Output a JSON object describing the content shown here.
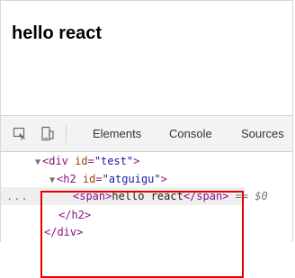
{
  "page": {
    "heading": "hello react"
  },
  "devtools": {
    "tabs": {
      "elements": "Elements",
      "console": "Console",
      "sources": "Sources"
    },
    "icons": {
      "inspect": "inspect-element-icon",
      "device": "device-toolbar-icon"
    },
    "dom": {
      "line1": {
        "open": "<div ",
        "attr": "id",
        "eq": "=",
        "value": "\"test\"",
        "close": ">"
      },
      "line2": {
        "open": "<h2 ",
        "attr": "id",
        "eq": "=",
        "value": "\"atguigu\"",
        "close": ">"
      },
      "line3": {
        "open": "<span>",
        "text": "hello react",
        "close": "</span>",
        "meta": " == $0",
        "ellipsis": "..."
      },
      "line4": {
        "text": "</h2>"
      },
      "line5": {
        "text": "</div>"
      }
    },
    "colors": {
      "highlight": "#e60000",
      "tag": "#881280",
      "attrName": "#994500",
      "attrValue": "#1a1aa6"
    }
  }
}
